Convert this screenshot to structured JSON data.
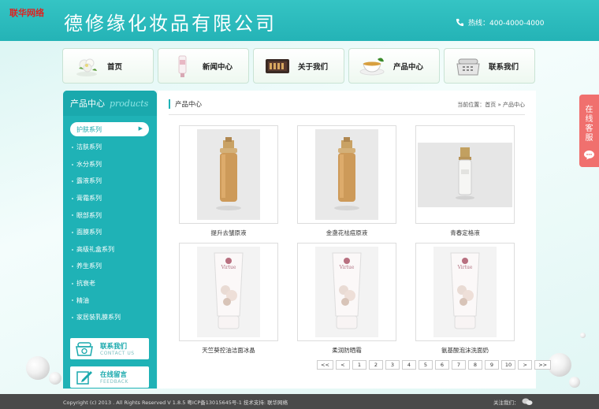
{
  "watermark": "联华网络",
  "header": {
    "company": "德修缘化妆品有限公司",
    "hotline": "热线：400-4000-4000"
  },
  "nav": [
    {
      "label": "首页",
      "icon": "flower-icon"
    },
    {
      "label": "新闻中心",
      "icon": "tube-icon"
    },
    {
      "label": "关于我们",
      "icon": "box-icon"
    },
    {
      "label": "产品中心",
      "icon": "teacup-icon"
    },
    {
      "label": "联系我们",
      "icon": "telephone-icon"
    }
  ],
  "sidebar": {
    "title": "产品中心",
    "subtitle": "products",
    "categories": [
      "护肤系列",
      "洁肤系列",
      "水分系列",
      "露液系列",
      "膏霜系列",
      "眼部系列",
      "面膜系列",
      "高级礼盒系列",
      "养生系列",
      "抗衰老",
      "精油",
      "家居装乳膜系列"
    ],
    "active_index": 0,
    "contact": {
      "title": "联系我们",
      "sub": "CONTACT US"
    },
    "feedback": {
      "title": "在线留言",
      "sub": "FEEDBACK"
    }
  },
  "main": {
    "title": "产品中心",
    "breadcrumb": "当前位置：首页 » 产品中心",
    "products": [
      {
        "name": "提升去皱原液",
        "type": "amber-bottle"
      },
      {
        "name": "金盏花祛痘原液",
        "type": "amber-bottle"
      },
      {
        "name": "青春定格液",
        "type": "clear-bottle"
      },
      {
        "name": "天竺葵控油洁面冰晶",
        "type": "tube"
      },
      {
        "name": "柔润防晒霜",
        "type": "tube"
      },
      {
        "name": "氨基酸泡沫洗面奶",
        "type": "tube"
      }
    ],
    "pager": [
      "<<",
      "<",
      "1",
      "2",
      "3",
      "4",
      "5",
      "6",
      "7",
      "8",
      "9",
      "10",
      ">",
      ">>"
    ]
  },
  "footer": {
    "copyright": "Copyright (c) 2013 . All Rights Reserved V 1.8.5 粤ICP备13015645号-1 技术支持: 联华网络",
    "follow": "关注我们："
  },
  "kefu": "在线客服",
  "colors": {
    "primary": "#1fb2b6",
    "header": "#2cbcbd",
    "kefu": "#f0706e",
    "footer": "#4a4a4a"
  }
}
